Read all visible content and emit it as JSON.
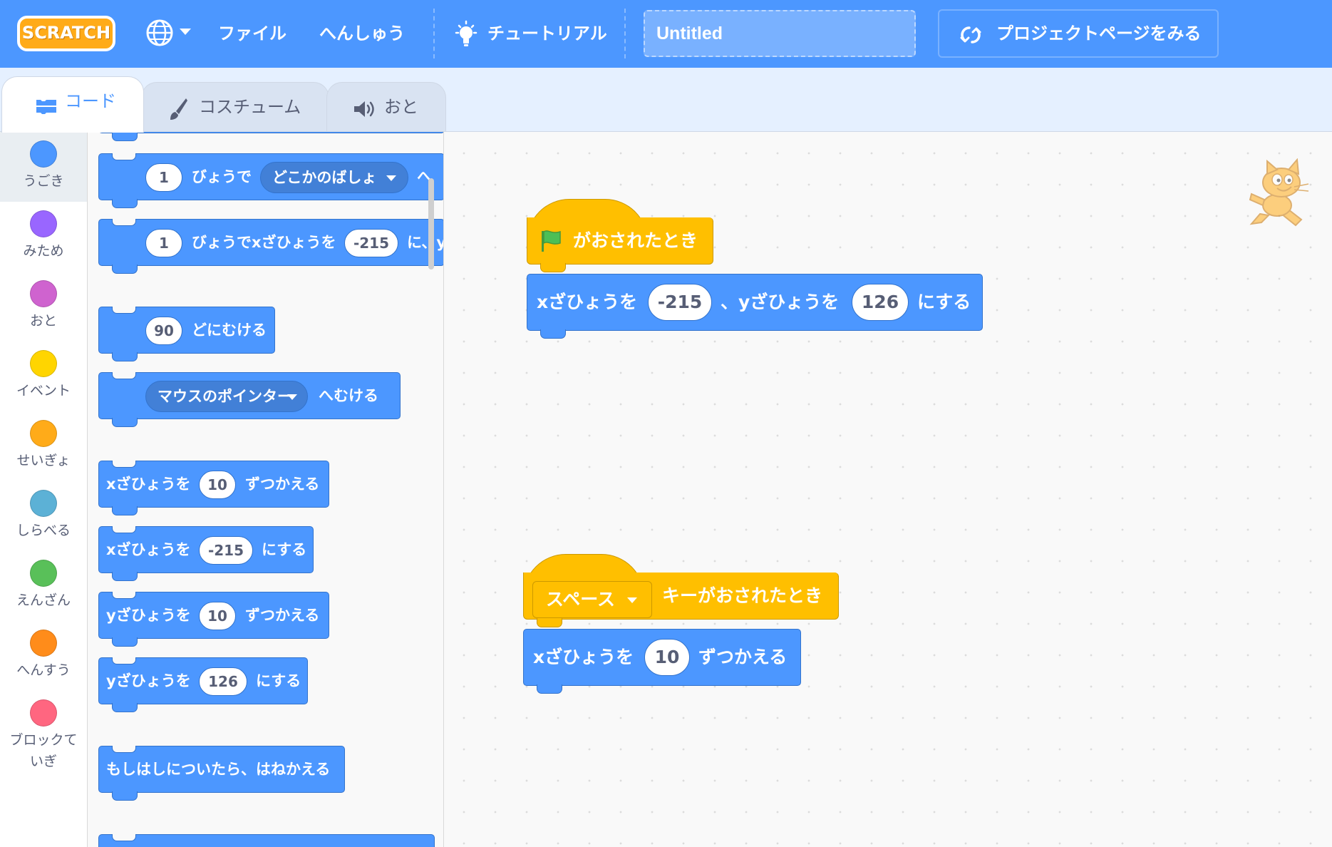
{
  "menubar": {
    "logo": "SCRATCH",
    "file": "ファイル",
    "edit": "へんしゅう",
    "tutorials": "チュートリアル",
    "project_title": "Untitled",
    "see_project_page": "プロジェクトページをみる",
    "globe_icon": "globe-icon",
    "accent_color": "#4c97ff"
  },
  "tabs": {
    "code": "コード",
    "costumes": "コスチューム",
    "sounds": "おと"
  },
  "categories": [
    {
      "label": "うごき",
      "color": "#4c97ff"
    },
    {
      "label": "みため",
      "color": "#9966ff"
    },
    {
      "label": "おと",
      "color": "#cf63cf"
    },
    {
      "label": "イベント",
      "color": "#ffd500"
    },
    {
      "label": "せいぎょ",
      "color": "#ffab19"
    },
    {
      "label": "しらべる",
      "color": "#5cb1d6"
    },
    {
      "label": "えんざん",
      "color": "#59c059"
    },
    {
      "label": "へんすう",
      "color": "#ff8c1a"
    },
    {
      "label": "ブロックて",
      "label2": "いぎ",
      "color": "#ff6680"
    }
  ],
  "palette": {
    "glide_random": {
      "secs": "1",
      "text1": "びょうで",
      "menu": "どこかのばしょ",
      "text2": "へ"
    },
    "glide_xy": {
      "secs": "1",
      "text1": "びょうでxざひょうを",
      "x": "-215",
      "text2": "に、y"
    },
    "point_dir": {
      "value": "90",
      "text": "どにむける"
    },
    "point_towards": {
      "menu": "マウスのポインター",
      "text": "へむける"
    },
    "change_x": {
      "text1": "xざひょうを",
      "value": "10",
      "text2": "ずつかえる"
    },
    "set_x": {
      "text1": "xざひょうを",
      "value": "-215",
      "text2": "にする"
    },
    "change_y": {
      "text1": "yざひょうを",
      "value": "10",
      "text2": "ずつかえる"
    },
    "set_y": {
      "text1": "yざひょうを",
      "value": "126",
      "text2": "にする"
    },
    "bounce": {
      "text": "もしはしについたら、はねかえる"
    }
  },
  "workspace": {
    "script1": {
      "hat": "がおされたとき",
      "goto_text1": "xざひょうを",
      "x": "-215",
      "goto_text2": "、yざひょうを",
      "y": "126",
      "goto_text3": "にする"
    },
    "script2": {
      "key": "スペース",
      "hat_text": "キーがおされたとき",
      "text1": "xざひょうを",
      "value": "10",
      "text2": "ずつかえる"
    }
  }
}
